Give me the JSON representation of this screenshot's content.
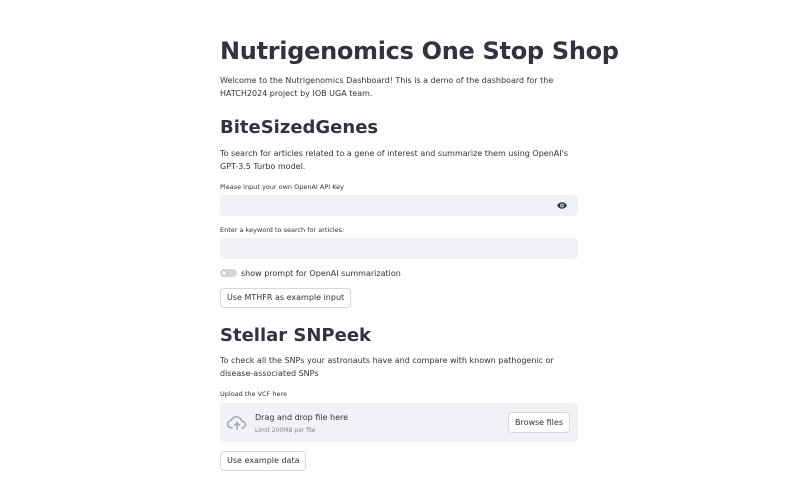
{
  "page": {
    "title": "Nutrigenomics One Stop Shop",
    "welcome": "Welcome to the Nutrigenomics Dashboard! This is a demo of the dashboard for the HATCH2024 project by IOB UGA team."
  },
  "bitesized": {
    "heading": "BiteSizedGenes",
    "description": "To search for articles related to a gene of interest and summarize them using OpenAI's GPT-3.5 Turbo model.",
    "api_key_label": "Please input your own OpenAI API Key",
    "api_key_value": "",
    "keyword_label": "Enter a keyword to search for articles:",
    "keyword_value": "",
    "toggle_label": "show prompt for OpenAI summarization",
    "toggle_on": false,
    "example_button": "Use MTHFR as example input"
  },
  "snpeek": {
    "heading": "Stellar SNPeek",
    "description": "To check all the SNPs your astronauts have and compare with known pathogenic or disease-associated SNPs",
    "upload_label": "Upload the VCF here",
    "dropzone_title": "Drag and drop file here",
    "dropzone_limit": "Limit 200MB per file",
    "browse_button": "Browse files",
    "example_button": "Use example data"
  },
  "icons": {
    "eye": "eye-icon",
    "cloud_upload": "cloud-upload-icon"
  },
  "colors": {
    "text": "#31333f",
    "input_bg": "#f0f2f6",
    "muted": "#808495",
    "icon": "#a3a8b8"
  }
}
